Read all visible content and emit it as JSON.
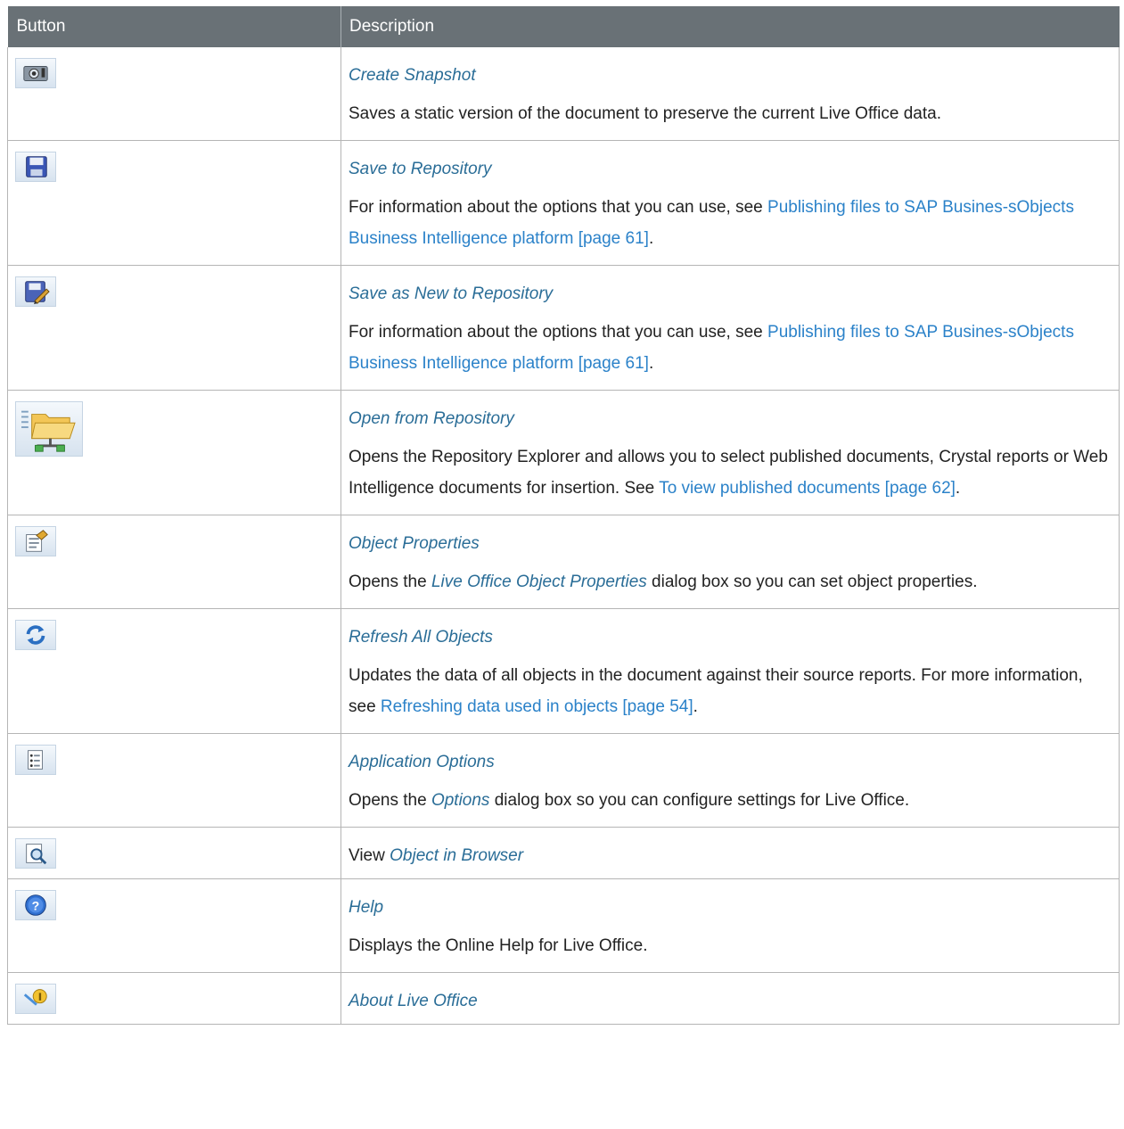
{
  "header": {
    "button": "Button",
    "description": "Description"
  },
  "rows": [
    {
      "icon": "camera-icon",
      "title": "Create Snapshot",
      "desc": "Saves a static version of the document to preserve the current Live Office data."
    },
    {
      "icon": "floppy-disk-icon",
      "title": "Save to Repository",
      "desc_pre": "For information about the options that you can use, see ",
      "desc_link": "Publishing files to SAP Busines-sObjects Business Intelligence platform [page 61]",
      "desc_post": "."
    },
    {
      "icon": "save-as-new-icon",
      "title": "Save as New to Repository",
      "desc_pre": "For information about the options that you can use, see ",
      "desc_link": "Publishing files to SAP Busines-sObjects Business Intelligence platform [page 61]",
      "desc_post": "."
    },
    {
      "icon": "network-folder-icon",
      "title": "Open from Repository",
      "desc_pre": "Opens the Repository Explorer and allows you to select published documents, Crystal reports or Web Intelligence documents for insertion. See ",
      "desc_link": "To view published documents [page 62]",
      "desc_post": "."
    },
    {
      "icon": "properties-icon",
      "title": "Object Properties",
      "desc_pre": "Opens the ",
      "desc_em": "Live Office Object Properties",
      "desc_post": " dialog box so you can set object properties."
    },
    {
      "icon": "refresh-icon",
      "title": "Refresh All Objects",
      "desc_pre": "Updates the data of all objects in the document against their source reports. For more information, see ",
      "desc_link": "Refreshing data used in objects [page 54]",
      "desc_post": "."
    },
    {
      "icon": "options-icon",
      "title": "Application Options",
      "desc_pre": "Opens the ",
      "desc_em": "Options",
      "desc_post": " dialog box so you can configure settings for Live Office."
    },
    {
      "icon": "view-in-browser-icon",
      "text_pre": "View ",
      "text_em": "Object in Browser"
    },
    {
      "icon": "help-icon",
      "title": "Help",
      "desc": "Displays the Online Help for Live Office."
    },
    {
      "icon": "about-icon",
      "title": "About Live Office"
    }
  ]
}
